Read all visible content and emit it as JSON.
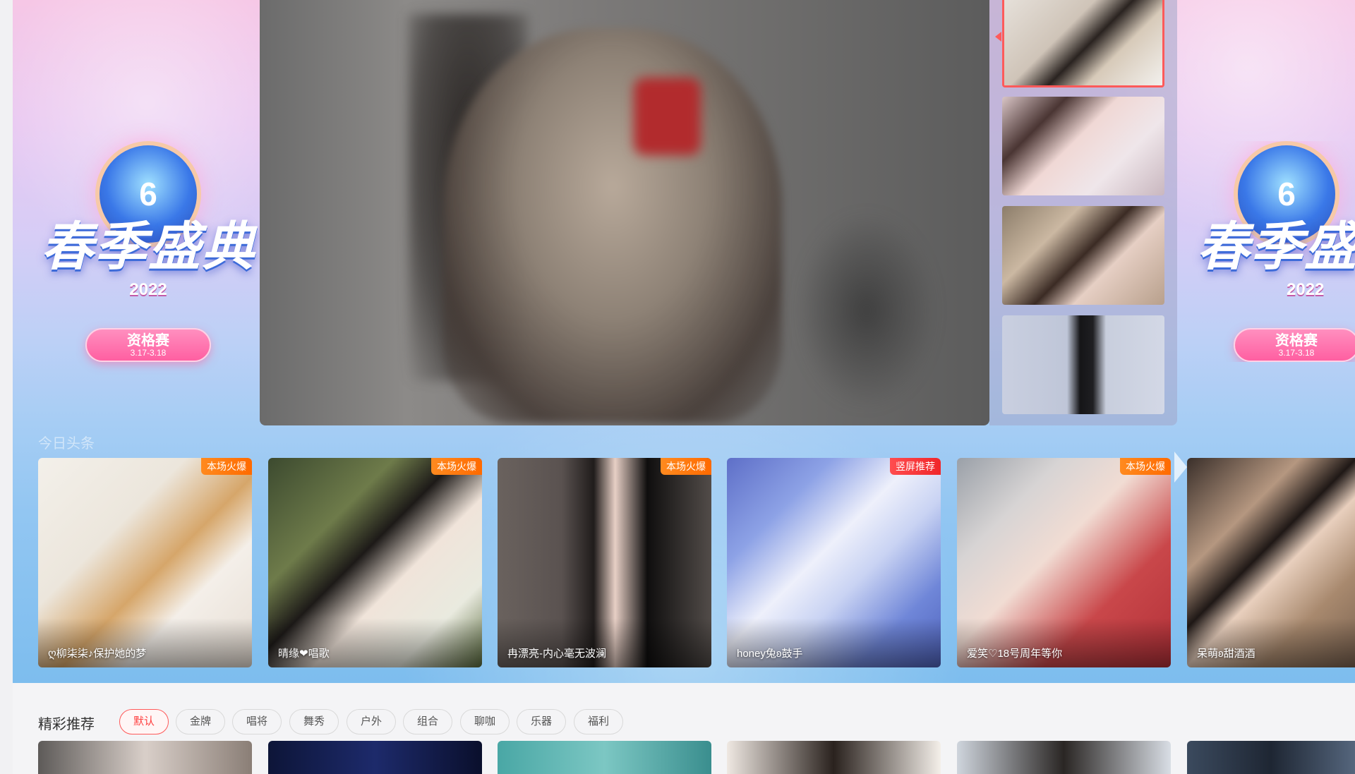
{
  "banner": {
    "event_title_left": "春季盛典",
    "event_title_right": "春季盛典",
    "event_year": "2022",
    "event_stage": "资格赛",
    "event_dates": "3.17-3.18",
    "crystal_number": "6"
  },
  "hot_section": {
    "title": "今日头条",
    "cards": [
      {
        "name": "ღ柳柒柒♪保护她的梦",
        "badge": "本场火爆",
        "badge_color": "#ff7a10"
      },
      {
        "name": "晴缘❤唱歌",
        "badge": "本场火爆",
        "badge_color": "#ff7a10"
      },
      {
        "name": "冉漂亮-内心毫无波澜",
        "badge": "本场火爆",
        "badge_color": "#ff7a10"
      },
      {
        "name": "honey兔ʚ鼓手",
        "badge": "竖屏推荐",
        "badge_color": "#f0262a"
      },
      {
        "name": "爱笑♡18号周年等你",
        "badge": "本场火爆",
        "badge_color": "#ff7a10"
      },
      {
        "name": "呆萌ʚ甜酒酒",
        "badge": "",
        "badge_color": "#ff7a10"
      }
    ]
  },
  "recommend": {
    "title": "精彩推荐",
    "filters": [
      "默认",
      "金牌",
      "唱将",
      "舞秀",
      "户外",
      "组合",
      "聊咖",
      "乐器",
      "福利"
    ],
    "active_filter": "默认"
  },
  "colors": {
    "accent": "#ff5a5a",
    "badge_orange": "#ff7a10",
    "badge_red": "#f0262a"
  }
}
